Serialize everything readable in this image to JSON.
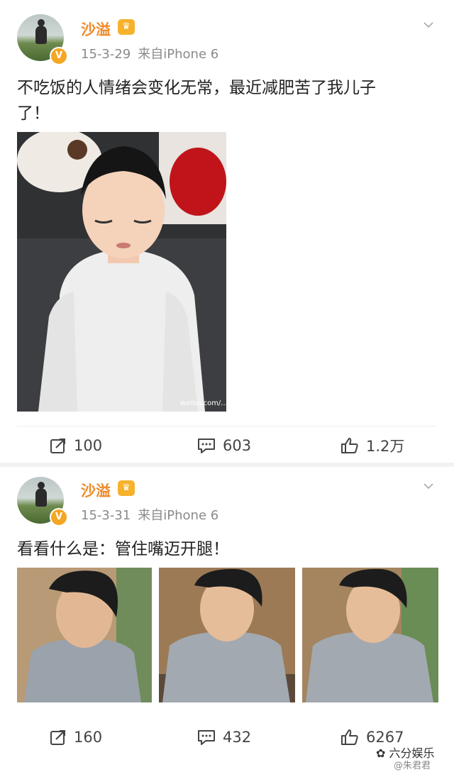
{
  "posts": [
    {
      "username": "沙溢",
      "vip_icon": "crown-icon",
      "verified_badge": "V",
      "date": "15-3-29",
      "source": "来自iPhone 6",
      "text_line1": "不吃饭的人情绪会变化无常，最近减肥苦了我儿子",
      "text_line2": "了！",
      "image_watermark": "weibo.com/...",
      "actions": {
        "repost": "100",
        "comment": "603",
        "like": "1.2万"
      }
    },
    {
      "username": "沙溢",
      "vip_icon": "crown-icon",
      "verified_badge": "V",
      "date": "15-3-31",
      "source": "来自iPhone 6",
      "text_line1": "看看什么是：管住嘴迈开腿！",
      "actions": {
        "repost": "160",
        "comment": "432",
        "like": "6267"
      }
    }
  ],
  "watermark": {
    "brand": "六分娱乐",
    "handle": "@朱君君"
  },
  "colors": {
    "username": "#f08a2a",
    "vip": "#f6b22d",
    "meta": "#8a8a8a"
  }
}
